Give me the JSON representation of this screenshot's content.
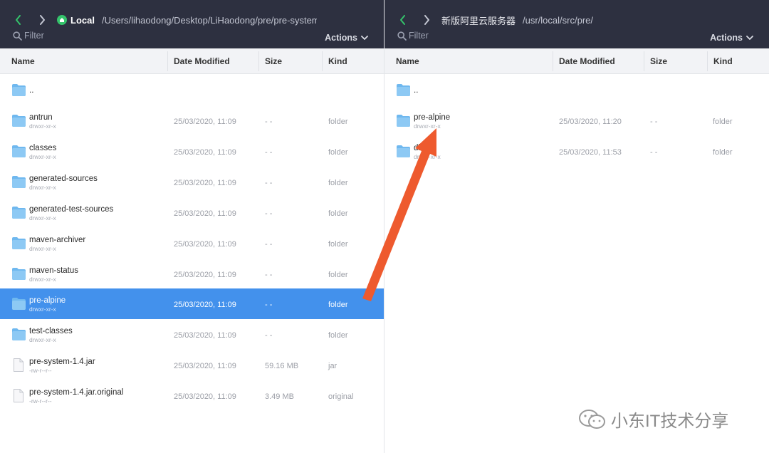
{
  "left_pane": {
    "location_label": "Local",
    "path": "/Users/lihaodong/Desktop/LiHaodong/pre/pre-system/target",
    "filter_placeholder": "Filter",
    "actions_label": "Actions",
    "columns": [
      "Name",
      "Date Modified",
      "Size",
      "Kind"
    ],
    "rows": [
      {
        "name": "..",
        "perm": "",
        "date": "",
        "size": "",
        "kind": "",
        "icon": "folder-icon"
      },
      {
        "name": "antrun",
        "perm": "drwxr-xr-x",
        "date": "25/03/2020, 11:09",
        "size": "- -",
        "kind": "folder",
        "icon": "folder-icon"
      },
      {
        "name": "classes",
        "perm": "drwxr-xr-x",
        "date": "25/03/2020, 11:09",
        "size": "- -",
        "kind": "folder",
        "icon": "folder-icon"
      },
      {
        "name": "generated-sources",
        "perm": "drwxr-xr-x",
        "date": "25/03/2020, 11:09",
        "size": "- -",
        "kind": "folder",
        "icon": "folder-icon"
      },
      {
        "name": "generated-test-sources",
        "perm": "drwxr-xr-x",
        "date": "25/03/2020, 11:09",
        "size": "- -",
        "kind": "folder",
        "icon": "folder-icon"
      },
      {
        "name": "maven-archiver",
        "perm": "drwxr-xr-x",
        "date": "25/03/2020, 11:09",
        "size": "- -",
        "kind": "folder",
        "icon": "folder-icon"
      },
      {
        "name": "maven-status",
        "perm": "drwxr-xr-x",
        "date": "25/03/2020, 11:09",
        "size": "- -",
        "kind": "folder",
        "icon": "folder-icon"
      },
      {
        "name": "pre-alpine",
        "perm": "drwxr-xr-x",
        "date": "25/03/2020, 11:09",
        "size": "- -",
        "kind": "folder",
        "icon": "folder-icon",
        "selected": true
      },
      {
        "name": "test-classes",
        "perm": "drwxr-xr-x",
        "date": "25/03/2020, 11:09",
        "size": "- -",
        "kind": "folder",
        "icon": "folder-icon"
      },
      {
        "name": "pre-system-1.4.jar",
        "perm": "-rw-r--r--",
        "date": "25/03/2020, 11:09",
        "size": "59.16 MB",
        "kind": "jar",
        "icon": "file-icon"
      },
      {
        "name": "pre-system-1.4.jar.original",
        "perm": "-rw-r--r--",
        "date": "25/03/2020, 11:09",
        "size": "3.49 MB",
        "kind": "original",
        "icon": "file-icon"
      }
    ]
  },
  "right_pane": {
    "location_label": "新版阿里云服务器",
    "path": "/usr/local/src/pre/",
    "filter_placeholder": "Filter",
    "actions_label": "Actions",
    "columns": [
      "Name",
      "Date Modified",
      "Size",
      "Kind"
    ],
    "rows": [
      {
        "name": "..",
        "perm": "",
        "date": "",
        "size": "",
        "kind": "",
        "icon": "folder-icon"
      },
      {
        "name": "pre-alpine",
        "perm": "drwxr-xr-x",
        "date": "25/03/2020, 11:20",
        "size": "- -",
        "kind": "folder",
        "icon": "folder-icon"
      },
      {
        "name": "dist",
        "perm": "drwxr-xr-x",
        "date": "25/03/2020, 11:53",
        "size": "- -",
        "kind": "folder",
        "icon": "folder-icon"
      }
    ]
  },
  "colors": {
    "toolbar_bg": "#2d3040",
    "selection": "#4391ec",
    "nav_green": "#34c36b",
    "folder": "#6fb8ef",
    "arrow": "#ee5a2e"
  },
  "watermark": {
    "text": "小东IT技术分享",
    "icon": "wechat-logo"
  }
}
